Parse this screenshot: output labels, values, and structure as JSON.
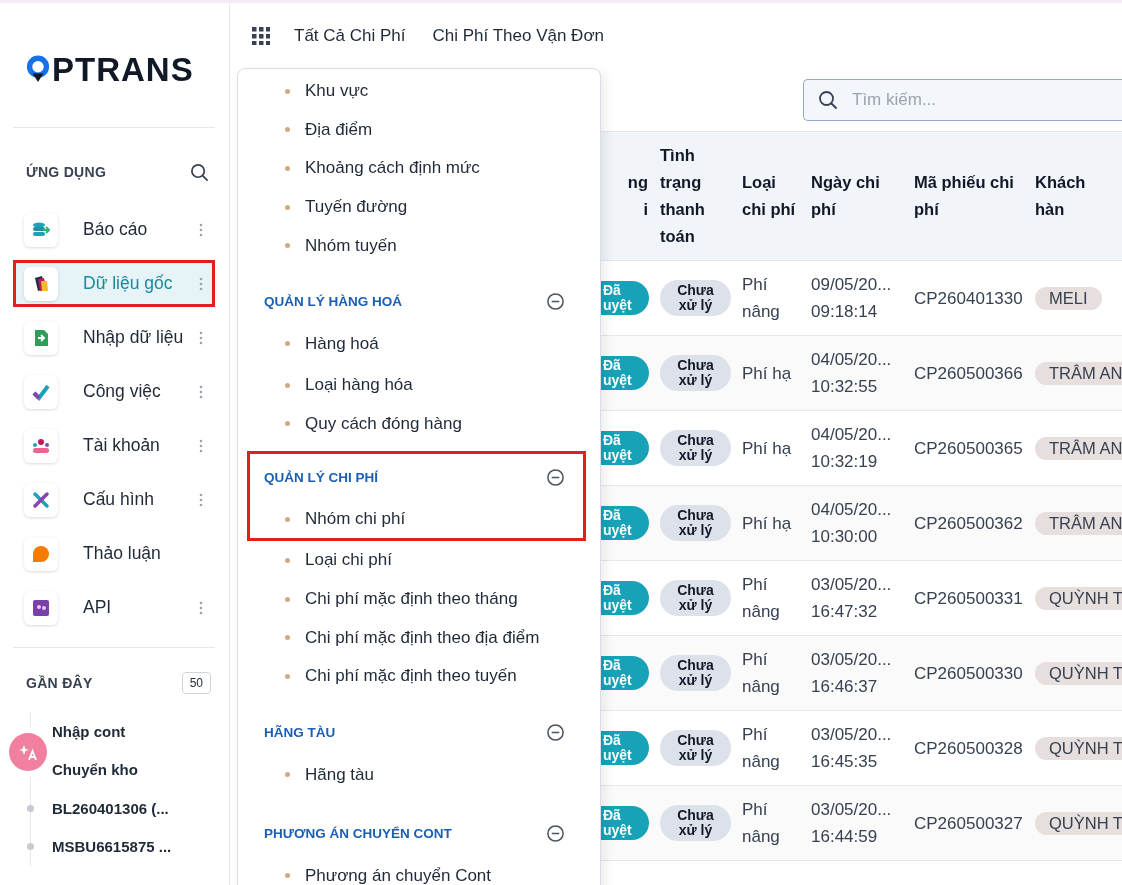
{
  "sidebar": {
    "logo": {
      "text": "PTRANS"
    },
    "apps_heading": "ỨNG DỤNG",
    "apps": [
      {
        "label": "Báo cáo",
        "selected": false,
        "highlighted": false,
        "has_menu": true
      },
      {
        "label": "Dữ liệu gốc",
        "selected": true,
        "highlighted": true,
        "has_menu": true
      },
      {
        "label": "Nhập dữ liệu",
        "selected": false,
        "highlighted": false,
        "has_menu": true
      },
      {
        "label": "Công việc",
        "selected": false,
        "highlighted": false,
        "has_menu": true
      },
      {
        "label": "Tài khoản",
        "selected": false,
        "highlighted": false,
        "has_menu": true
      },
      {
        "label": "Cấu hình",
        "selected": false,
        "highlighted": false,
        "has_menu": true
      },
      {
        "label": "Thảo luận",
        "selected": false,
        "highlighted": false,
        "has_menu": false
      },
      {
        "label": "API",
        "selected": false,
        "highlighted": false,
        "has_menu": true
      }
    ],
    "recent_heading": "GẦN ĐÂY",
    "recent_count": "50",
    "recent": [
      "Nhập cont",
      "Chuyển kho",
      "BL260401306 (...",
      "MSBU6615875 ..."
    ]
  },
  "top_bar": {
    "tabs": [
      {
        "label": "Tất Cả Chi Phí"
      },
      {
        "label": "Chi Phí Theo Vận Đơn"
      }
    ]
  },
  "search": {
    "placeholder": "Tìm kiếm..."
  },
  "dropdown": {
    "groups": [
      {
        "items": [
          "Khu vực",
          "Địa điểm",
          "Khoảng cách định mức",
          "Tuyến đường",
          "Nhóm tuyến"
        ]
      },
      {
        "title": "QUẢN LÝ HÀNG HOÁ",
        "expanded": true,
        "highlighted": false,
        "items": [
          "Hàng hoá",
          "Loại hàng hóa",
          "Quy cách đóng hàng"
        ]
      },
      {
        "title": "QUẢN LÝ CHI PHÍ",
        "expanded": true,
        "highlighted": true,
        "items": [
          "Nhóm chi phí",
          "Loại chi phí",
          "Chi phí mặc định theo tháng",
          "Chi phí mặc định theo địa điểm",
          "Chi phí mặc định theo tuyến"
        ]
      },
      {
        "title": "HÃNG TÀU",
        "expanded": true,
        "highlighted": false,
        "items": [
          "Hãng tàu"
        ]
      },
      {
        "title": "PHƯƠNG ÁN CHUYỂN CONT",
        "expanded": true,
        "highlighted": false,
        "items": [
          "Phương án chuyển Cont"
        ]
      }
    ]
  },
  "table": {
    "columns": [
      "ng\ni",
      "Tình trạng thanh toán",
      "Loại chi phí",
      "Ngày chi phí",
      "Mã phiếu chi phí",
      "Khách hàn"
    ],
    "rows": [
      {
        "approval": "Đã uyệt",
        "payment": "Chưa xử lý",
        "cost_type": "Phí nâng",
        "date": "09/05/20...",
        "time": "09:18:14",
        "code": "CP260401330",
        "customer": "MELI"
      },
      {
        "approval": "Đã uyệt",
        "payment": "Chưa xử lý",
        "cost_type": "Phí hạ",
        "date": "04/05/20...",
        "time": "10:32:55",
        "code": "CP260500366",
        "customer": "TRÂM AN"
      },
      {
        "approval": "Đã uyệt",
        "payment": "Chưa xử lý",
        "cost_type": "Phí hạ",
        "date": "04/05/20...",
        "time": "10:32:19",
        "code": "CP260500365",
        "customer": "TRÂM AN"
      },
      {
        "approval": "Đã uyệt",
        "payment": "Chưa xử lý",
        "cost_type": "Phí hạ",
        "date": "04/05/20...",
        "time": "10:30:00",
        "code": "CP260500362",
        "customer": "TRÂM AN"
      },
      {
        "approval": "Đã uyệt",
        "payment": "Chưa xử lý",
        "cost_type": "Phí nâng",
        "date": "03/05/20...",
        "time": "16:47:32",
        "code": "CP260500331",
        "customer": "QUỲNH T"
      },
      {
        "approval": "Đã uyệt",
        "payment": "Chưa xử lý",
        "cost_type": "Phí nâng",
        "date": "03/05/20...",
        "time": "16:46:37",
        "code": "CP260500330",
        "customer": "QUỲNH T"
      },
      {
        "approval": "Đã uyệt",
        "payment": "Chưa xử lý",
        "cost_type": "Phí nâng",
        "date": "03/05/20...",
        "time": "16:45:35",
        "code": "CP260500328",
        "customer": "QUỲNH T"
      },
      {
        "approval": "Đã uyệt",
        "payment": "Chưa xử lý",
        "cost_type": "Phí nâng",
        "date": "03/05/20...",
        "time": "16:44:59",
        "code": "CP260500327",
        "customer": "QUỲNH T"
      }
    ]
  }
}
